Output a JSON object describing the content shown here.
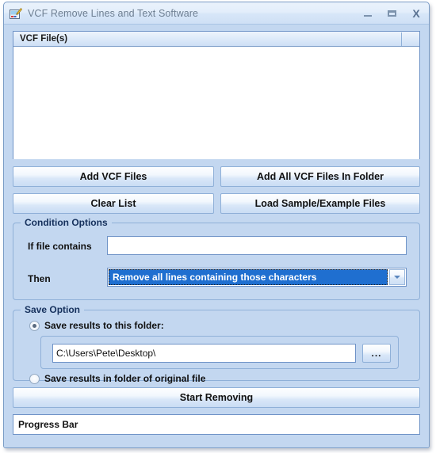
{
  "window": {
    "title": "VCF Remove Lines and Text Software",
    "icon": "app-paint-icon",
    "controls": {
      "minimize": "minimize-icon",
      "maximize": "maximize-icon",
      "close": "X"
    }
  },
  "file_list": {
    "column_header": "VCF File(s)",
    "rows": []
  },
  "buttons": {
    "add_vcf_files": "Add VCF Files",
    "add_all_vcf_files_in_folder": "Add All VCF Files In Folder",
    "clear_list": "Clear List",
    "load_sample_example_files": "Load Sample/Example Files",
    "start_removing": "Start Removing"
  },
  "condition_options": {
    "group_title": "Condition Options",
    "if_file_contains_label": "If file contains",
    "if_file_contains_value": "",
    "if_file_contains_placeholder": "",
    "then_label": "Then",
    "then_selected": "Remove all lines containing those characters",
    "then_options": [
      "Remove all lines containing those characters"
    ]
  },
  "save_option": {
    "group_title": "Save Option",
    "radio_this_folder_label": "Save results to this folder:",
    "radio_this_folder_selected": true,
    "folder_path_value": "C:\\Users\\Pete\\Desktop\\",
    "browse_label": "...",
    "radio_original_folder_label": "Save results in folder of original file",
    "radio_original_folder_selected": false
  },
  "progress": {
    "text": "Progress Bar"
  },
  "colors": {
    "window_background": "#c3d7f0",
    "titlebar_text": "#6e7f92",
    "group_title": "#15305c",
    "selection_blue": "#1f6fd0",
    "border_blue": "#8fb0d8"
  }
}
